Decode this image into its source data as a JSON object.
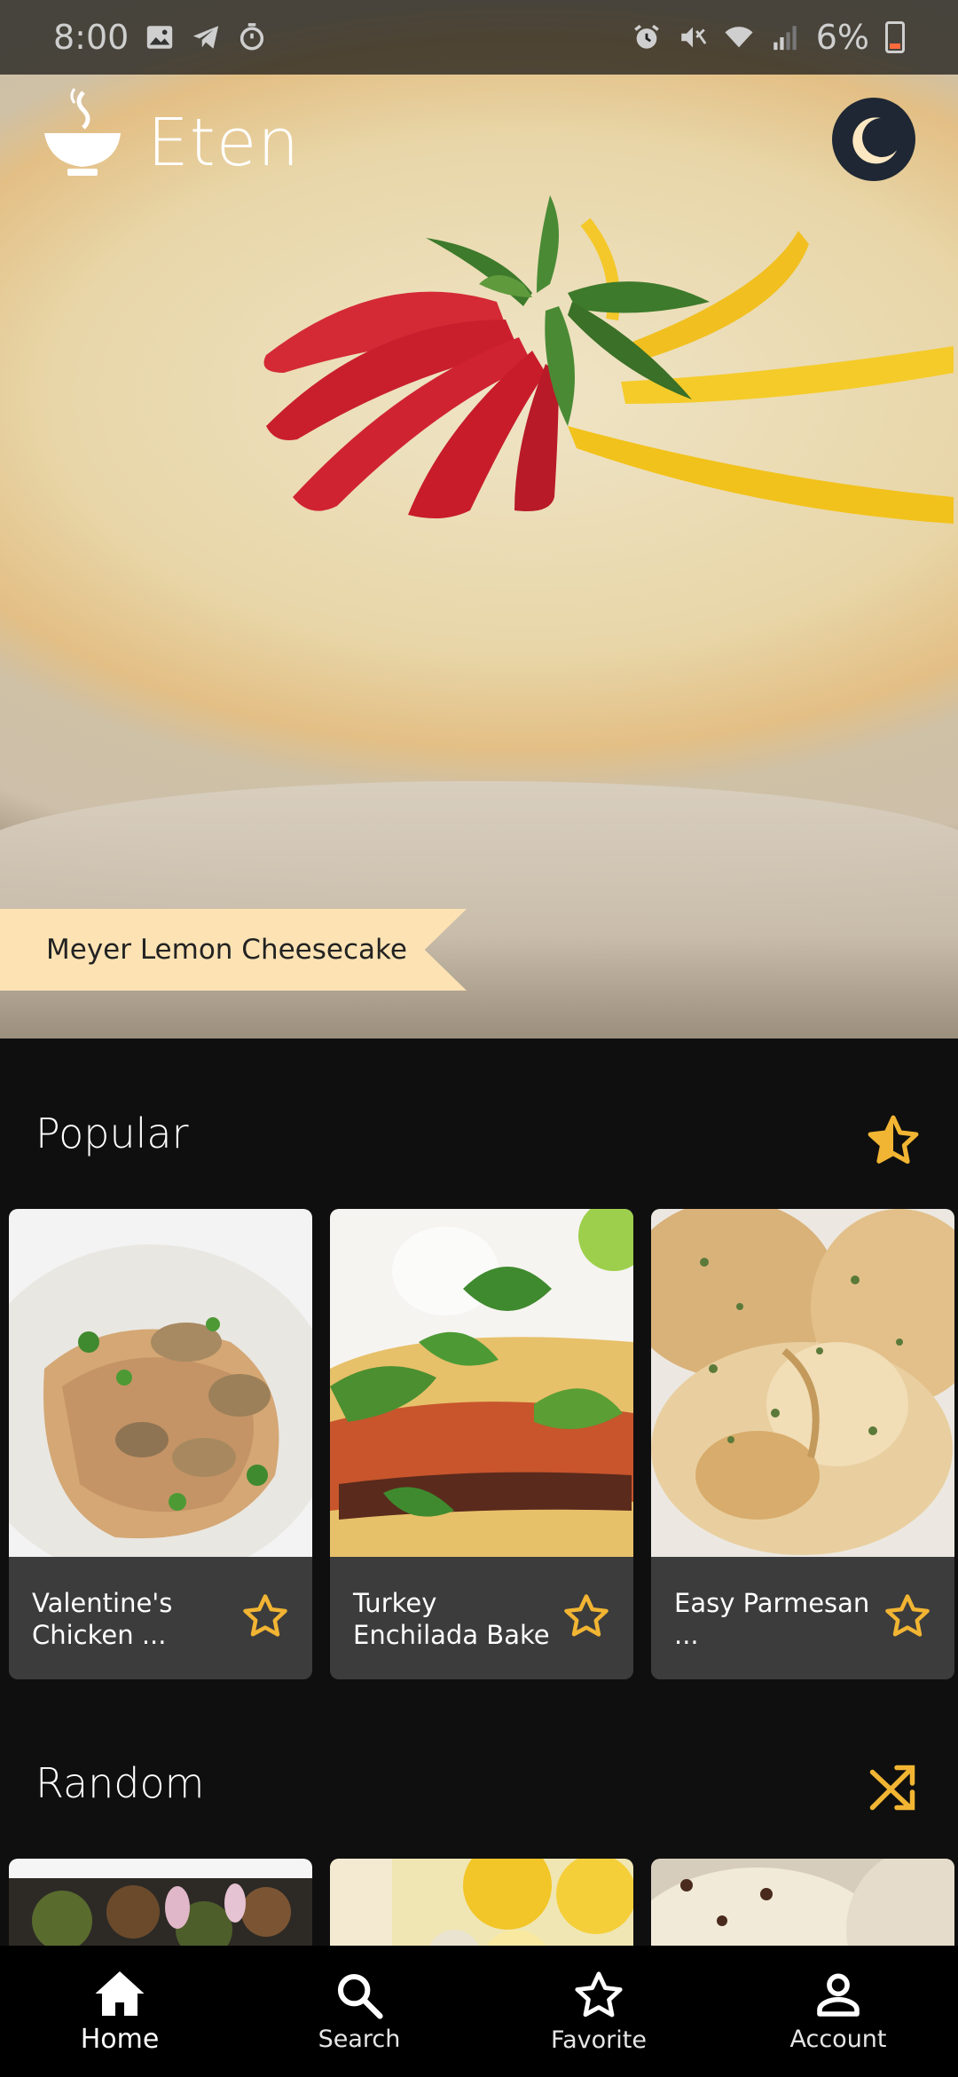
{
  "status_bar": {
    "time": "8:00",
    "battery": "6%",
    "left_icons": [
      "gallery-icon",
      "telegram-icon",
      "timer-icon"
    ],
    "right_icons": [
      "alarm-icon",
      "mute-icon",
      "wifi-icon",
      "signal-icon",
      "battery-icon"
    ]
  },
  "header": {
    "app_name": "Eten",
    "logo_icon": "steaming-bowl-icon",
    "theme_toggle_icon": "moon-icon"
  },
  "hero": {
    "featured_recipe": "Meyer Lemon Cheesecake"
  },
  "popular": {
    "title": "Popular",
    "icon": "star-half-icon",
    "cards": [
      {
        "name": "Valentine's Chicken ...",
        "favorite_icon": "star-outline-icon"
      },
      {
        "name": "Turkey Enchilada Bake",
        "favorite_icon": "star-outline-icon"
      },
      {
        "name": "Easy Parmesan ...",
        "favorite_icon": "star-outline-icon"
      }
    ]
  },
  "random": {
    "title": "Random",
    "icon": "shuffle-icon"
  },
  "bottom_nav": {
    "items": [
      {
        "label": "Home",
        "icon": "home-icon",
        "active": true
      },
      {
        "label": "Search",
        "icon": "search-icon",
        "active": false
      },
      {
        "label": "Favorite",
        "icon": "star-outline-icon",
        "active": false
      },
      {
        "label": "Account",
        "icon": "account-icon",
        "active": false
      }
    ]
  },
  "colors": {
    "accent": "#f2b533",
    "background": "#0f0f0f",
    "card": "#3c3c3c",
    "ribbon": "#fde3b4",
    "theme_button": "#1e2733"
  }
}
